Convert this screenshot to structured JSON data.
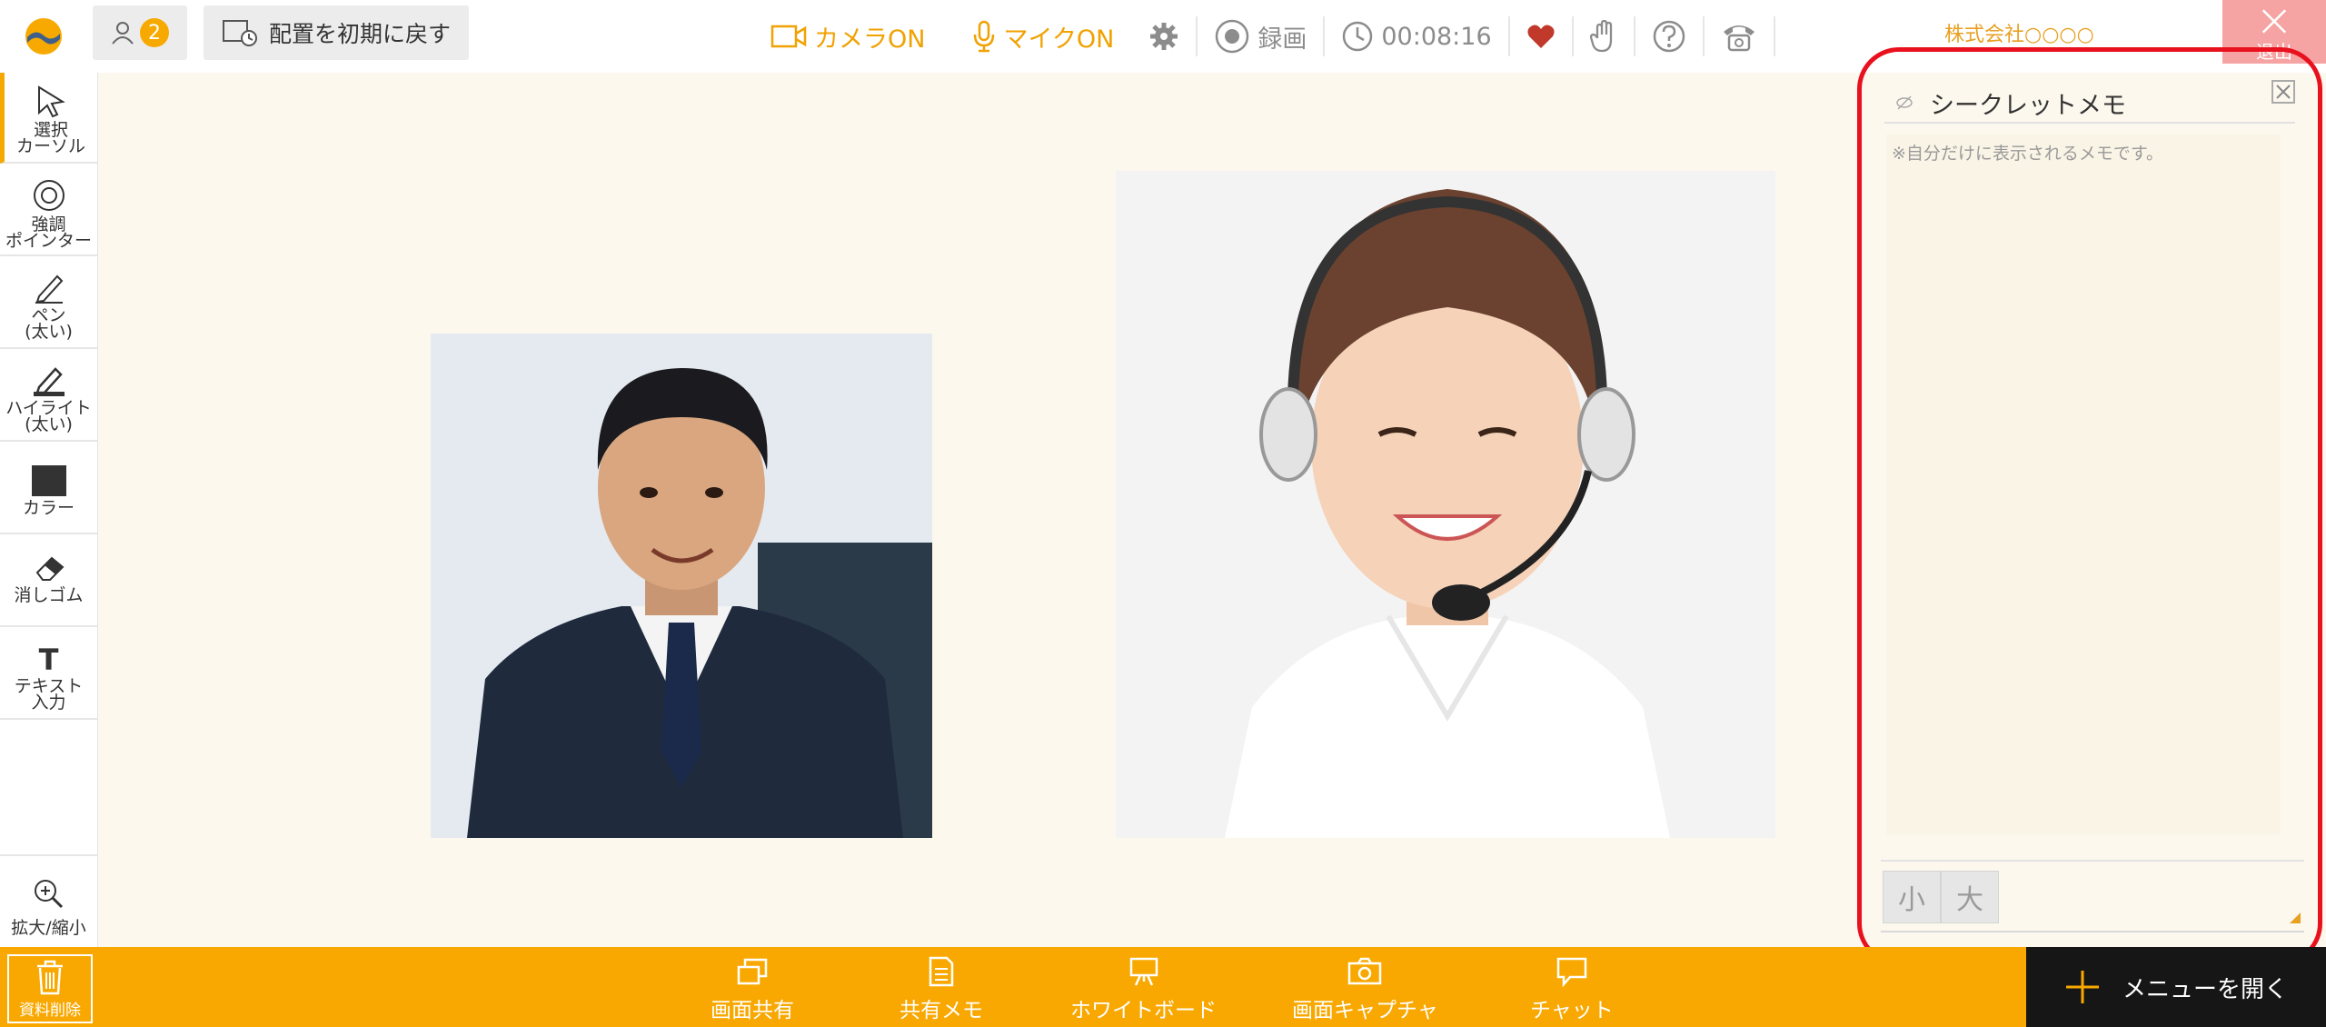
{
  "topbar": {
    "participant_count": "2",
    "reset_layout_label": "配置を初期に戻す",
    "camera_label": "カメラON",
    "mic_label": "マイクON",
    "record_label": "録画",
    "timer": "00:08:16",
    "company_name": "株式会社○○○○",
    "exit_label": "退出",
    "accent_color": "#f0a202"
  },
  "tools": {
    "select": "選択\nカーソル",
    "pointer": "強調\nポインター",
    "pen": "ペン\n(太い)",
    "highlight": "ハイライト\n(太い)",
    "color": "カラー",
    "eraser": "消しゴム",
    "text": "テキスト\n入力",
    "zoom": "拡大/縮小"
  },
  "memo": {
    "title": "シークレットメモ",
    "placeholder": "※自分だけに表示されるメモです。",
    "size_small": "小",
    "size_large": "大"
  },
  "bottombar": {
    "delete_material": "資料削除",
    "screen_share": "画面共有",
    "shared_memo": "共有メモ",
    "whiteboard": "ホワイトボード",
    "screen_capture": "画面キャプチャ",
    "chat": "チャット",
    "open_menu": "メニューを開く",
    "bar_color": "#f8a800"
  }
}
